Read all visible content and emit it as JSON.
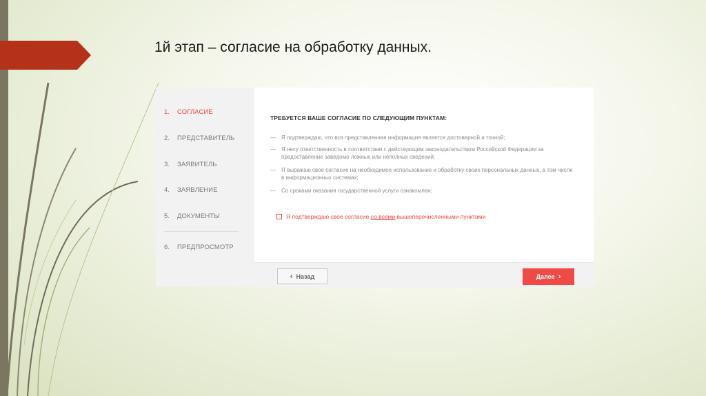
{
  "slide": {
    "title": "1й этап – согласие на обработку данных."
  },
  "wizard": {
    "steps": [
      {
        "num": "1.",
        "label": "СОГЛАСИЕ",
        "active": true
      },
      {
        "num": "2.",
        "label": "ПРЕДСТАВИТЕЛЬ"
      },
      {
        "num": "3.",
        "label": "ЗАЯВИТЕЛЬ"
      },
      {
        "num": "4.",
        "label": "ЗАЯВЛЕНИЕ"
      },
      {
        "num": "5.",
        "label": "ДОКУМЕНТЫ"
      },
      {
        "num": "6.",
        "label": "ПРЕДПРОСМОТР"
      }
    ],
    "consent_heading": "ТРЕБУЕТСЯ ВАШЕ СОГЛАСИЕ ПО СЛЕДУЮЩИМ ПУНКТАМ:",
    "items": [
      "Я подтверждаю, что вся представленная информация является достоверной и точной;",
      "Я несу ответственность в соответствии с действующим законодательством Российской Федерации за предоставление заведомо ложных или неполных сведений;",
      "Я выражаю свое согласие на необходимое использование и обработку своих персональных данных, в том числе в информационных системах;",
      "Со сроками оказания государственной услуги ознакомлен;"
    ],
    "dash": "—",
    "agree": {
      "checked": false,
      "before": "Я подтверждаю свое согласие ",
      "link": "со всеми",
      "after": " вышеперечисленными пунктами"
    },
    "back_label": "Назад",
    "next_label": "Далее",
    "back_icon": "‹",
    "next_icon": "›"
  },
  "colors": {
    "accent": "#ef4a45",
    "banner": "#b5321a",
    "sidebar_bar": "#7a7660"
  }
}
